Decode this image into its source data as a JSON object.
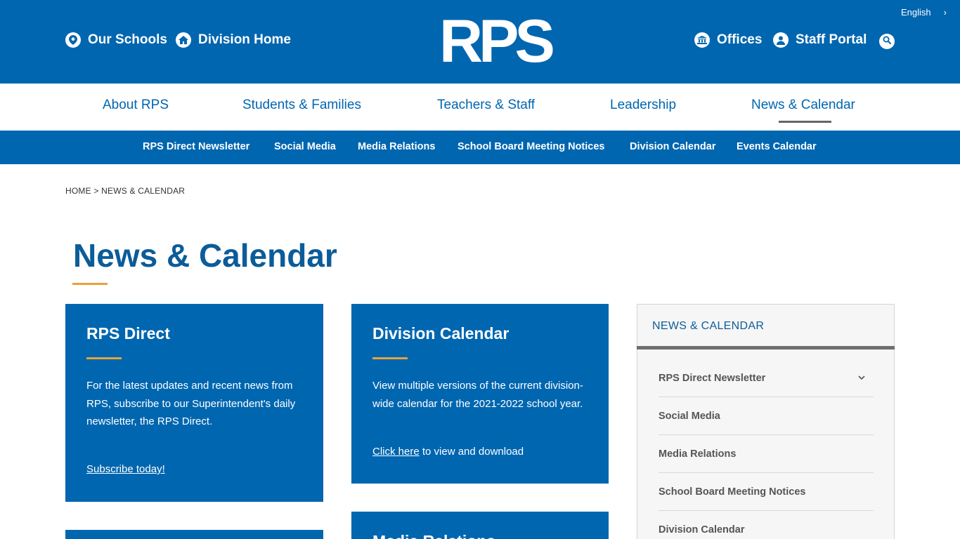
{
  "header": {
    "logo_text": "RPS",
    "language": "English",
    "links": {
      "schools": "Our Schools",
      "home": "Division Home",
      "offices": "Offices",
      "staff": "Staff Portal"
    },
    "icons": {
      "schools": "map-pin-icon",
      "home": "house-icon",
      "offices": "building-icon",
      "staff": "user-icon",
      "search": "search-icon"
    }
  },
  "main_nav": [
    {
      "label": "About RPS"
    },
    {
      "label": "Students & Families"
    },
    {
      "label": "Teachers & Staff"
    },
    {
      "label": "Leadership"
    },
    {
      "label": "News & Calendar"
    }
  ],
  "sub_nav": [
    {
      "label": "RPS Direct Newsletter"
    },
    {
      "label": "Social Media"
    },
    {
      "label": "Media Relations"
    },
    {
      "label": "School Board Meeting Notices"
    },
    {
      "label": "Division Calendar"
    },
    {
      "label": "Events Calendar"
    }
  ],
  "breadcrumb": {
    "home": "HOME",
    "separator": ">",
    "current": "NEWS & CALENDAR"
  },
  "page": {
    "title": "News & Calendar"
  },
  "cards": {
    "direct": {
      "title": "RPS Direct",
      "body": "For the latest updates and recent news from RPS, subscribe to our Superintendent's daily newsletter, the RPS Direct.",
      "link": "Subscribe today!"
    },
    "calendar": {
      "title": "Division Calendar",
      "body": "View multiple versions of the current division-wide calendar for the 2021-2022 school year.",
      "link": "Click here",
      "link_suffix": " to view and download"
    },
    "media": {
      "title": "Media Relations"
    }
  },
  "sidebar": {
    "heading": "NEWS & CALENDAR",
    "items": [
      {
        "label": "RPS Direct Newsletter"
      },
      {
        "label": "Social Media"
      },
      {
        "label": "Media Relations"
      },
      {
        "label": "School Board Meeting Notices"
      },
      {
        "label": "Division Calendar"
      }
    ]
  },
  "colors": {
    "brand_blue": "#0066b0",
    "title_blue": "#0b5c99",
    "accent_gold": "#e8a13c"
  }
}
